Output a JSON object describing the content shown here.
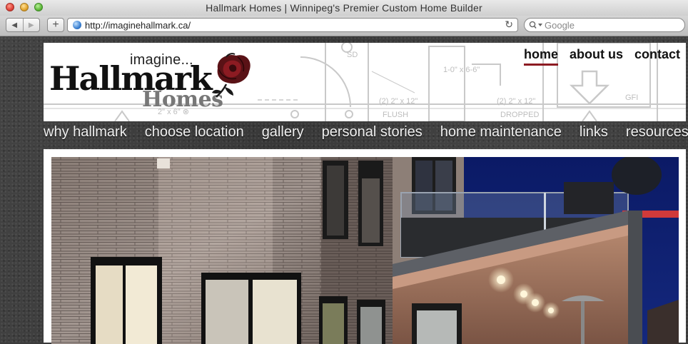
{
  "window": {
    "title": "Hallmark Homes | Winnipeg's Premier Custom Home Builder"
  },
  "toolbar": {
    "back_glyph": "◀",
    "forward_glyph": "▶",
    "add_glyph": "+",
    "url": "http://imaginehallmark.ca/",
    "reload_glyph": "↻",
    "search_placeholder": "Google"
  },
  "logo": {
    "small": "imagine...",
    "main": "Hallmark",
    "sub": "Homes"
  },
  "top_nav": [
    {
      "label": "home"
    },
    {
      "label": "about us"
    },
    {
      "label": "contact"
    }
  ],
  "main_nav": [
    {
      "label": "why hallmark"
    },
    {
      "label": "choose location"
    },
    {
      "label": "gallery"
    },
    {
      "label": "personal stories"
    },
    {
      "label": "home maintenance"
    },
    {
      "label": "links"
    },
    {
      "label": "resources"
    }
  ],
  "blueprint_labels": [
    "(2) 2\" x 12\"",
    "FLUSH",
    "(2) 2\" x 12\"",
    "DROPPED",
    "1-0\" x 6-6\"",
    "SD",
    "2\" x 6\" ⊗",
    "GFI"
  ],
  "colors": {
    "accent": "#8c1b22",
    "nav_text": "#f0f0f0"
  },
  "icons": {
    "back": "back-arrow-icon",
    "forward": "forward-arrow-icon",
    "add": "plus-icon",
    "site": "globe-icon",
    "reload": "reload-icon",
    "search": "search-icon",
    "logo_rose": "rose-icon"
  }
}
